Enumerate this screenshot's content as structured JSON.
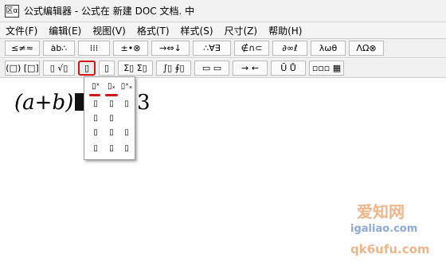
{
  "window": {
    "icon_label": "区α",
    "title": "公式编辑器 - 公式在 新建 DOC 文档. 中"
  },
  "menu": [
    "文件(F)",
    "编辑(E)",
    "视图(V)",
    "格式(T)",
    "样式(S)",
    "尺寸(Z)",
    "帮助(H)"
  ],
  "toolbar_row1": [
    "≤≠≈",
    "ȧb∴",
    "⁞⁞⁞",
    "±•⊗",
    "→⇔↓",
    "∴∀∃",
    "∉∩⊂",
    "∂∞ℓ",
    "λωθ",
    "ΛΩ⊗"
  ],
  "toolbar_row2": [
    "(□) [□]",
    "▯ √▯",
    "▯",
    "▯",
    "Σ▯ Σ▯",
    "∫▯ ∮▯",
    "▭ ▭",
    "→ ←",
    "Ū Ů",
    "▫▫▫ ▦"
  ],
  "formula": {
    "left": "(a",
    "op": "+",
    "right": "b)",
    "trail": "3"
  },
  "dropdown_templates": [
    "▯ˣ",
    "▯ₓ",
    "▯ˣₓ",
    "▯",
    "▯",
    "▯",
    "▯",
    "▯",
    "▯",
    "▯",
    "▯",
    "▯",
    "▯",
    "▯"
  ],
  "watermark": {
    "line1": "爱知网",
    "line2": "igaliao.com",
    "line3": "qk6ufu.com"
  },
  "colors": {
    "highlight": "#d01818",
    "watermark_orange": "#e07a2e",
    "watermark_blue": "#2f63b8"
  }
}
